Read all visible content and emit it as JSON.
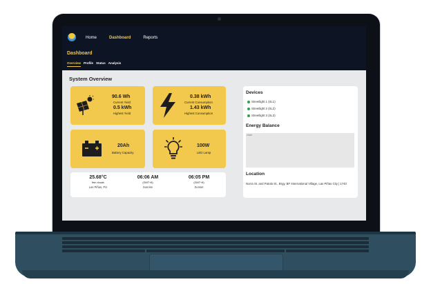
{
  "nav": {
    "home": "Home",
    "dashboard": "Dashboard",
    "reports": "Reports"
  },
  "page": {
    "title": "Dashboard"
  },
  "subtabs": [
    "Overview",
    "Profile",
    "Status",
    "Analysis"
  ],
  "overview": {
    "title": "System Overview",
    "yield": {
      "current_value": "90.6 Wh",
      "current_label": "Current Yield",
      "highest_value": "0.5 kWh",
      "highest_label": "Highest Yield"
    },
    "consumption": {
      "current_value": "0.38 kWh",
      "current_label": "Current Consumption",
      "highest_value": "1.43 kWh",
      "highest_label": "Highest Consumption"
    },
    "battery": {
      "value": "20Ah",
      "label": "Battery Capacity"
    },
    "lamp": {
      "value": "100W",
      "label": "LED Lamp"
    }
  },
  "weather": {
    "temp": "25.68°C",
    "condition": "few clouds",
    "place": "Las Piñas, PH",
    "sunrise_time": "06:06 AM",
    "sunrise_tz": "(GMT+8)",
    "sunrise_label": "Sunrise",
    "sunset_time": "06:05 PM",
    "sunset_tz": "(GMT+8)",
    "sunset_label": "Sunset"
  },
  "devices": {
    "title": "Devices",
    "items": [
      "Streetlight 1 (SL1)",
      "Streetlight 2 (SL2)",
      "Streetlight 3 (SL3)"
    ],
    "status_color": "#2fa24b"
  },
  "energy": {
    "title": "Energy Balance",
    "chart_label": "chart"
  },
  "location": {
    "title": "Location",
    "address": "Norra St. and Patola St., Brgy. BF International Village, Las Piñas City | 1740"
  },
  "colors": {
    "accent": "#f2c94c",
    "header": "#0d1525"
  }
}
